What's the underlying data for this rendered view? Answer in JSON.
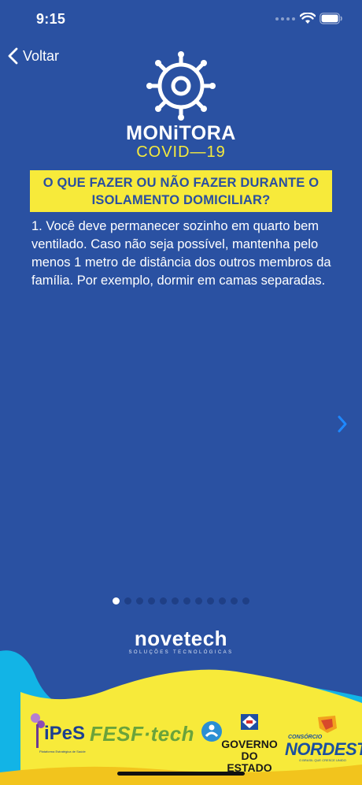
{
  "status_bar": {
    "time": "9:15"
  },
  "nav": {
    "back_label": "Voltar"
  },
  "logo": {
    "title": "MONiTORA",
    "subtitle": "COVID—19"
  },
  "card": {
    "question": "O QUE FAZER OU NÃO FAZER DURANTE O ISOLAMENTO DOMICILIAR?",
    "body": "1. Você deve permanecer sozinho em quarto bem ventilado. Caso não seja possível, mantenha pelo menos 1 metro de distância dos outros membros da família. Por exemplo, dormir em camas separadas."
  },
  "pagination": {
    "total": 12,
    "current": 1
  },
  "footer": {
    "brand": "novetech",
    "brand_tagline": "SOLUÇÕES TECNOLÓGICAS",
    "partners": {
      "ipes": "iPeS",
      "ipes_tagline": "Plataforma Estratégica de Saúde",
      "fesf": "FESF·tech",
      "governo": "GOVERNO DO ESTADO",
      "consorcio": "CONSÓRCIO",
      "nordeste": "NORDESTE",
      "nordeste_tagline": "O BRASIL QUE CRESCE UNIDO"
    }
  },
  "colors": {
    "background": "#2a51a2",
    "accent_yellow": "#f7ea3a",
    "question_text": "#2a4fa0",
    "footer_cyan": "#12b4e6"
  }
}
